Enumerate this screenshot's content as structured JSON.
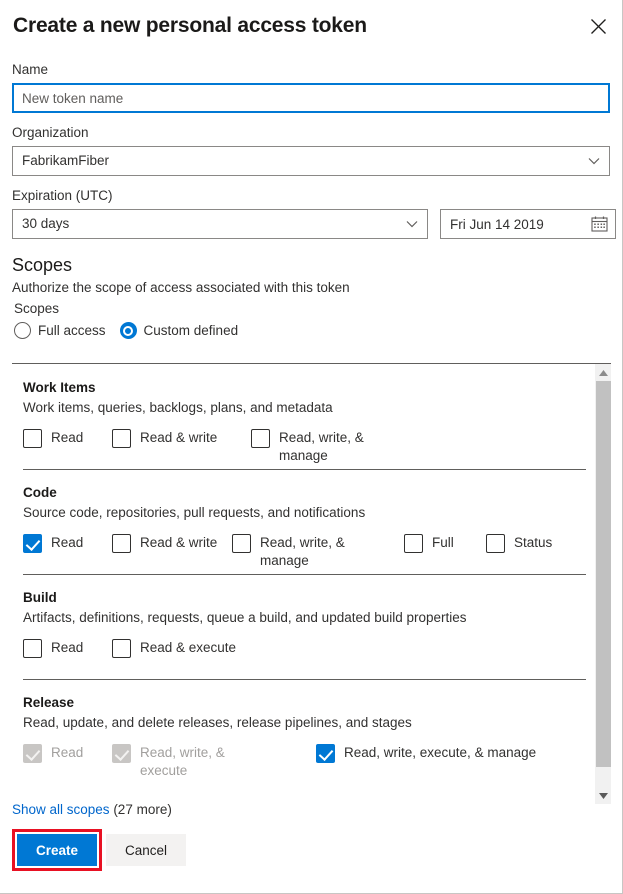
{
  "dialog": {
    "title": "Create a new personal access token",
    "close_icon": "close-icon"
  },
  "form": {
    "name_label": "Name",
    "name_placeholder": "New token name",
    "name_value": "",
    "organization_label": "Organization",
    "organization_value": "FabrikamFiber",
    "expiration_label": "Expiration (UTC)",
    "expiration_value": "30 days",
    "expiration_date": "Fri Jun 14 2019",
    "calendar_icon": "calendar-icon",
    "chevron_icon": "chevron-down-icon"
  },
  "scopes": {
    "heading": "Scopes",
    "description": "Authorize the scope of access associated with this token",
    "group_label": "Scopes",
    "options": [
      {
        "label": "Full access",
        "selected": false
      },
      {
        "label": "Custom defined",
        "selected": true
      }
    ],
    "groups": [
      {
        "name": "Work Items",
        "description": "Work items, queries, backlogs, plans, and metadata",
        "items": [
          {
            "label": "Read",
            "checked": false,
            "disabled": false
          },
          {
            "label": "Read & write",
            "checked": false,
            "disabled": false
          },
          {
            "label": "Read, write, & manage",
            "checked": false,
            "disabled": false
          }
        ]
      },
      {
        "name": "Code",
        "description": "Source code, repositories, pull requests, and notifications",
        "items": [
          {
            "label": "Read",
            "checked": true,
            "disabled": false
          },
          {
            "label": "Read & write",
            "checked": false,
            "disabled": false
          },
          {
            "label": "Read, write, & manage",
            "checked": false,
            "disabled": false
          },
          {
            "label": "Full",
            "checked": false,
            "disabled": false
          },
          {
            "label": "Status",
            "checked": false,
            "disabled": false
          }
        ]
      },
      {
        "name": "Build",
        "description": "Artifacts, definitions, requests, queue a build, and updated build properties",
        "items": [
          {
            "label": "Read",
            "checked": false,
            "disabled": false
          },
          {
            "label": "Read & execute",
            "checked": false,
            "disabled": false
          }
        ]
      },
      {
        "name": "Release",
        "description": "Read, update, and delete releases, release pipelines, and stages",
        "items": [
          {
            "label": "Read",
            "checked": true,
            "disabled": true
          },
          {
            "label": "Read, write, & execute",
            "checked": true,
            "disabled": true
          },
          {
            "label": "Read, write, execute, & manage",
            "checked": true,
            "disabled": false
          }
        ]
      }
    ],
    "scrollbar": {
      "up_icon": "scroll-up-arrow-icon",
      "down_icon": "scroll-down-arrow-icon"
    }
  },
  "footer": {
    "show_all_link": "Show all scopes",
    "show_all_count": " (27 more)",
    "create_label": "Create",
    "cancel_label": "Cancel"
  },
  "colors": {
    "accent": "#0078d4",
    "link": "#0066cc",
    "highlight": "#e81123",
    "border": "#8a8886",
    "disabled_text": "#a19f9d"
  }
}
